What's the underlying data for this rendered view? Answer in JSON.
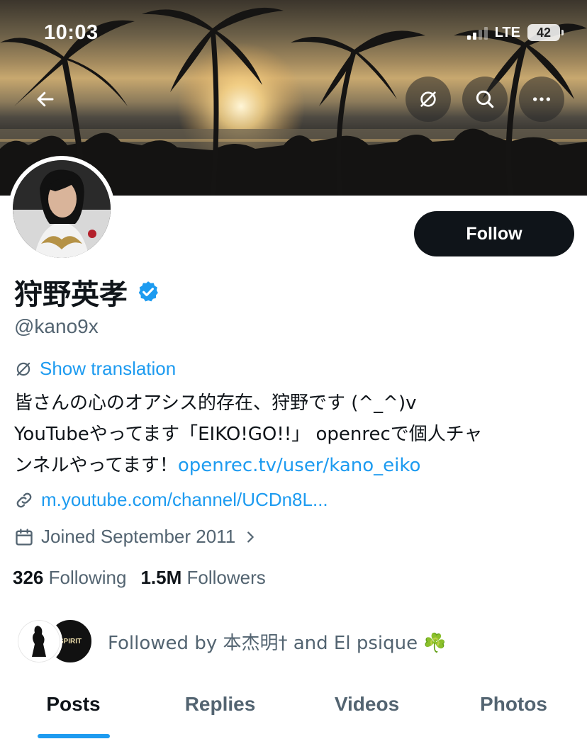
{
  "status_bar": {
    "time": "10:03",
    "network": "LTE",
    "battery": "42"
  },
  "nav": {
    "back_icon": "arrow-left-icon",
    "translate_icon": "translate-icon",
    "search_icon": "search-icon",
    "more_icon": "more-horizontal-icon"
  },
  "profile": {
    "display_name": "狩野英孝",
    "verified": true,
    "handle": "@kano9x",
    "follow_label": "Follow",
    "show_translation": "Show translation",
    "bio_line1": "皆さんの心のオアシス的存在、狩野です (^_^)v",
    "bio_line2": "YouTubeやってます「EIKO!GO!!」 openrecで個人チャ",
    "bio_line3_text": "ンネルやってます！",
    "bio_link": "openrec.tv/user/kano_eiko",
    "website": "m.youtube.com/channel/UCDn8L...",
    "joined": "Joined September 2011"
  },
  "stats": {
    "following_count": "326",
    "following_label": "Following",
    "followers_count": "1.5M",
    "followers_label": "Followers"
  },
  "followed_by": {
    "text": "Followed by 本杰明† and El psique ☘️",
    "avatar2_text": "SPIRIT"
  },
  "tabs": [
    {
      "label": "Posts",
      "active": true
    },
    {
      "label": "Replies",
      "active": false
    },
    {
      "label": "Videos",
      "active": false
    },
    {
      "label": "Photos",
      "active": false
    }
  ],
  "colors": {
    "accent": "#1d9bf0",
    "text_primary": "#0f1419",
    "text_secondary": "#536471",
    "button_dark": "#0f1419"
  }
}
